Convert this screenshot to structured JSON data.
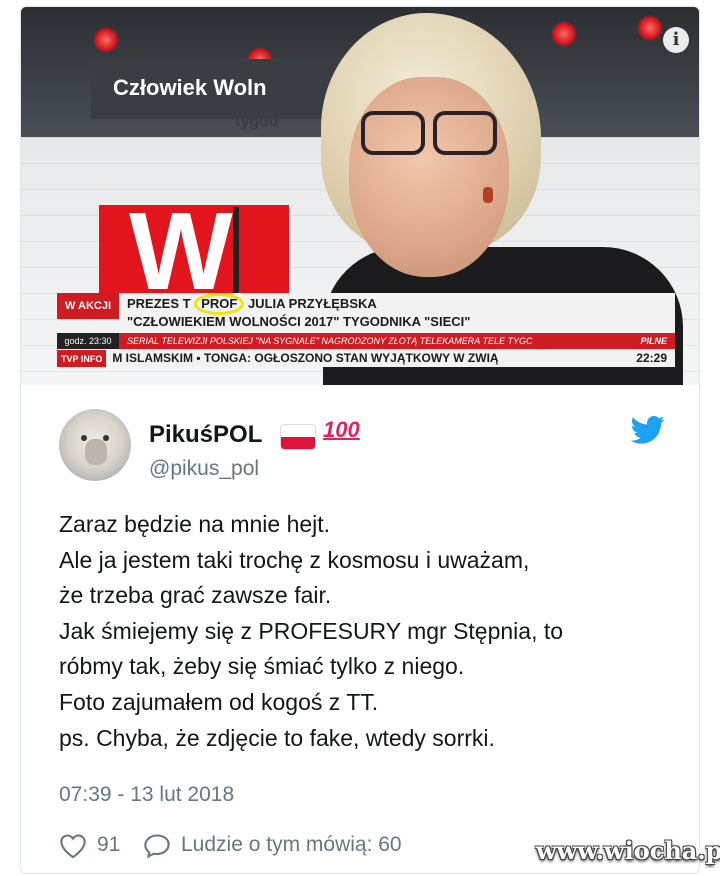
{
  "media": {
    "banner_title": "Człowiek Woln",
    "banner_sub": "tygod",
    "ticker": {
      "label": "W AKCJI",
      "time": "godz. 23:30",
      "headline_before": "PREZES T",
      "headline_highlight": "PROF",
      "headline_after": "JULIA PRZYŁĘBSKA",
      "headline_line2": "\"CZŁOWIEKIEM WOLNOŚCI 2017\" TYGODNIKA \"SIECI\"",
      "red_line": "SERIAL TELEWIZJI POLSKIEJ \"NA SYGNALE\" NAGRODZONY ZŁOTĄ TELEKAMERA TELE TYGC",
      "red_tag": "PILNE",
      "bottom_logo": "TVP INFO",
      "bottom_text": "M ISLAMSKIM ▪ TONGA: OGŁOSZONO STAN WYJĄTKOWY W ZWIĄ",
      "clock": "22:29"
    },
    "info_icon": "i"
  },
  "tweet": {
    "display_name": "PikuśPOL",
    "emoji_hundred": "💯",
    "handle": "@pikus_pol",
    "lines": [
      "Zaraz będzie na mnie hejt.",
      "Ale ja jestem taki trochę z kosmosu i uważam,",
      "że trzeba grać zawsze fair.",
      "Jak śmiejemy się z PROFESURY mgr Stępnia, to",
      "róbmy tak, żeby się śmiać tylko z niego.",
      "Foto zajumałem od kogoś z TT.",
      "ps. Chyba, że zdjęcie to fake, wtedy sorrki."
    ],
    "timestamp": "07:39 - 13 lut 2018",
    "likes": "91",
    "talking_label": "Ludzie o tym mówią: 60"
  },
  "watermark": "www.wiocha.pl",
  "colors": {
    "twitter_blue": "#1da1f2",
    "tvp_red": "#cf1b22",
    "text": "#14171a",
    "muted": "#657786"
  },
  "icons": [
    "info-icon",
    "twitter-bird-icon",
    "heart-icon",
    "reply-bubble-icon",
    "poland-flag-icon"
  ]
}
